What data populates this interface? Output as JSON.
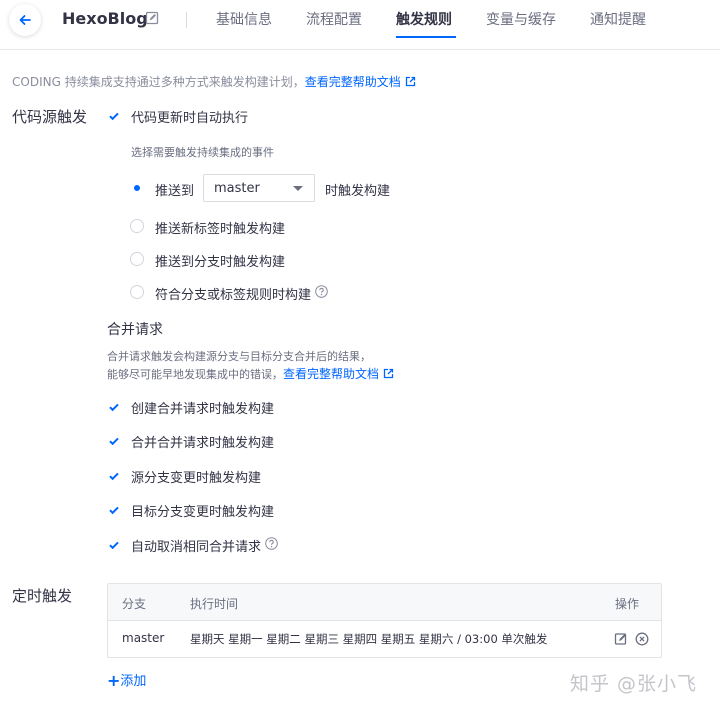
{
  "header": {
    "project_name": "HexoBlog",
    "tabs": [
      {
        "label": "基础信息"
      },
      {
        "label": "流程配置"
      },
      {
        "label": "触发规则"
      },
      {
        "label": "变量与缓存"
      },
      {
        "label": "通知提醒"
      }
    ],
    "active_tab": "触发规则"
  },
  "intro": {
    "text": "CODING 持续集成支持通过多种方式来触发构建计划，",
    "link": "查看完整帮助文档"
  },
  "code_trigger": {
    "label": "代码源触发",
    "auto_run": {
      "label": "代码更新时自动执行",
      "checked": true
    },
    "event_hint": "选择需要触发持续集成的事件",
    "push_prefix": "推送到",
    "branch_value": "master",
    "push_suffix": "时触发构建",
    "options": [
      {
        "label": "推送新标签时触发构建",
        "checked": false
      },
      {
        "label": "推送到分支时触发构建",
        "checked": false
      },
      {
        "label": "符合分支或标签规则时构建",
        "checked": false
      }
    ]
  },
  "merge_request": {
    "title": "合并请求",
    "desc_line1": "合并请求触发会构建源分支与目标分支合并后的结果，",
    "desc_line2": "能够尽可能早地发现集成中的错误，",
    "link": "查看完整帮助文档",
    "items": [
      {
        "label": "创建合并请求时触发构建",
        "checked": true
      },
      {
        "label": "合并合并请求时触发构建",
        "checked": true
      },
      {
        "label": "源分支变更时触发构建",
        "checked": true
      },
      {
        "label": "目标分支变更时触发构建",
        "checked": true
      },
      {
        "label": "自动取消相同合并请求",
        "checked": true
      }
    ]
  },
  "scheduled": {
    "label": "定时触发",
    "columns": {
      "branch": "分支",
      "time": "执行时间",
      "ops": "操作"
    },
    "rows": [
      {
        "branch": "master",
        "time": "星期天 星期一 星期二 星期三 星期四 星期五 星期六 / 03:00 单次触发"
      }
    ],
    "add_label": "添加"
  },
  "watermark": "知乎 @张小飞",
  "colors": {
    "accent": "#0066ff",
    "text": "#323345",
    "muted": "#8a8d9e"
  }
}
